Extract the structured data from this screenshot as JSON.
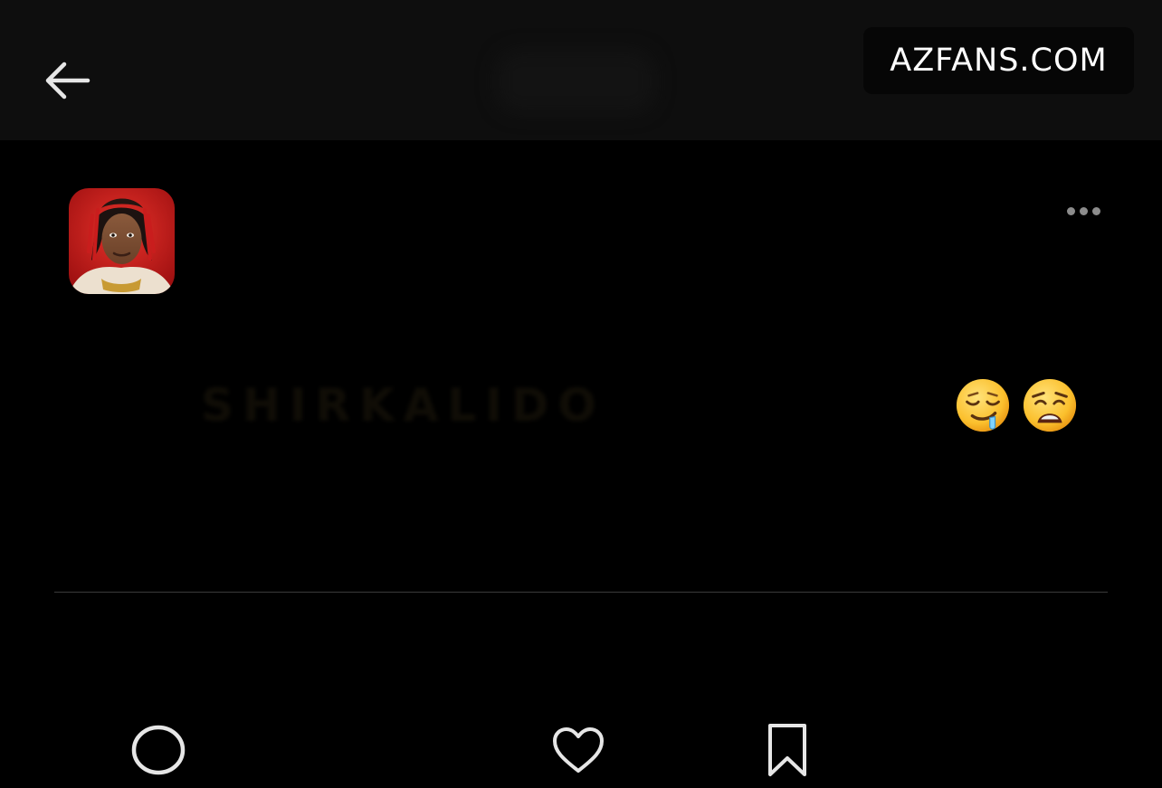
{
  "header": {
    "back_icon": "arrow-left-icon",
    "watermark": "AZFANS.COM"
  },
  "post": {
    "avatar_icon": "profile-photo",
    "more_icon": "more-horizontal-icon",
    "text": "SHIRKALIDO",
    "emojis": [
      "drooling-face",
      "weary-face"
    ]
  },
  "actions": {
    "comment_icon": "comment-icon",
    "like_icon": "heart-icon",
    "save_icon": "bookmark-icon"
  },
  "colors": {
    "background": "#000000",
    "header_background": "#0e0e0e",
    "icon_light": "#e6e6e6",
    "icon_muted": "#8c8c8c",
    "divider": "#3a3a3a"
  }
}
